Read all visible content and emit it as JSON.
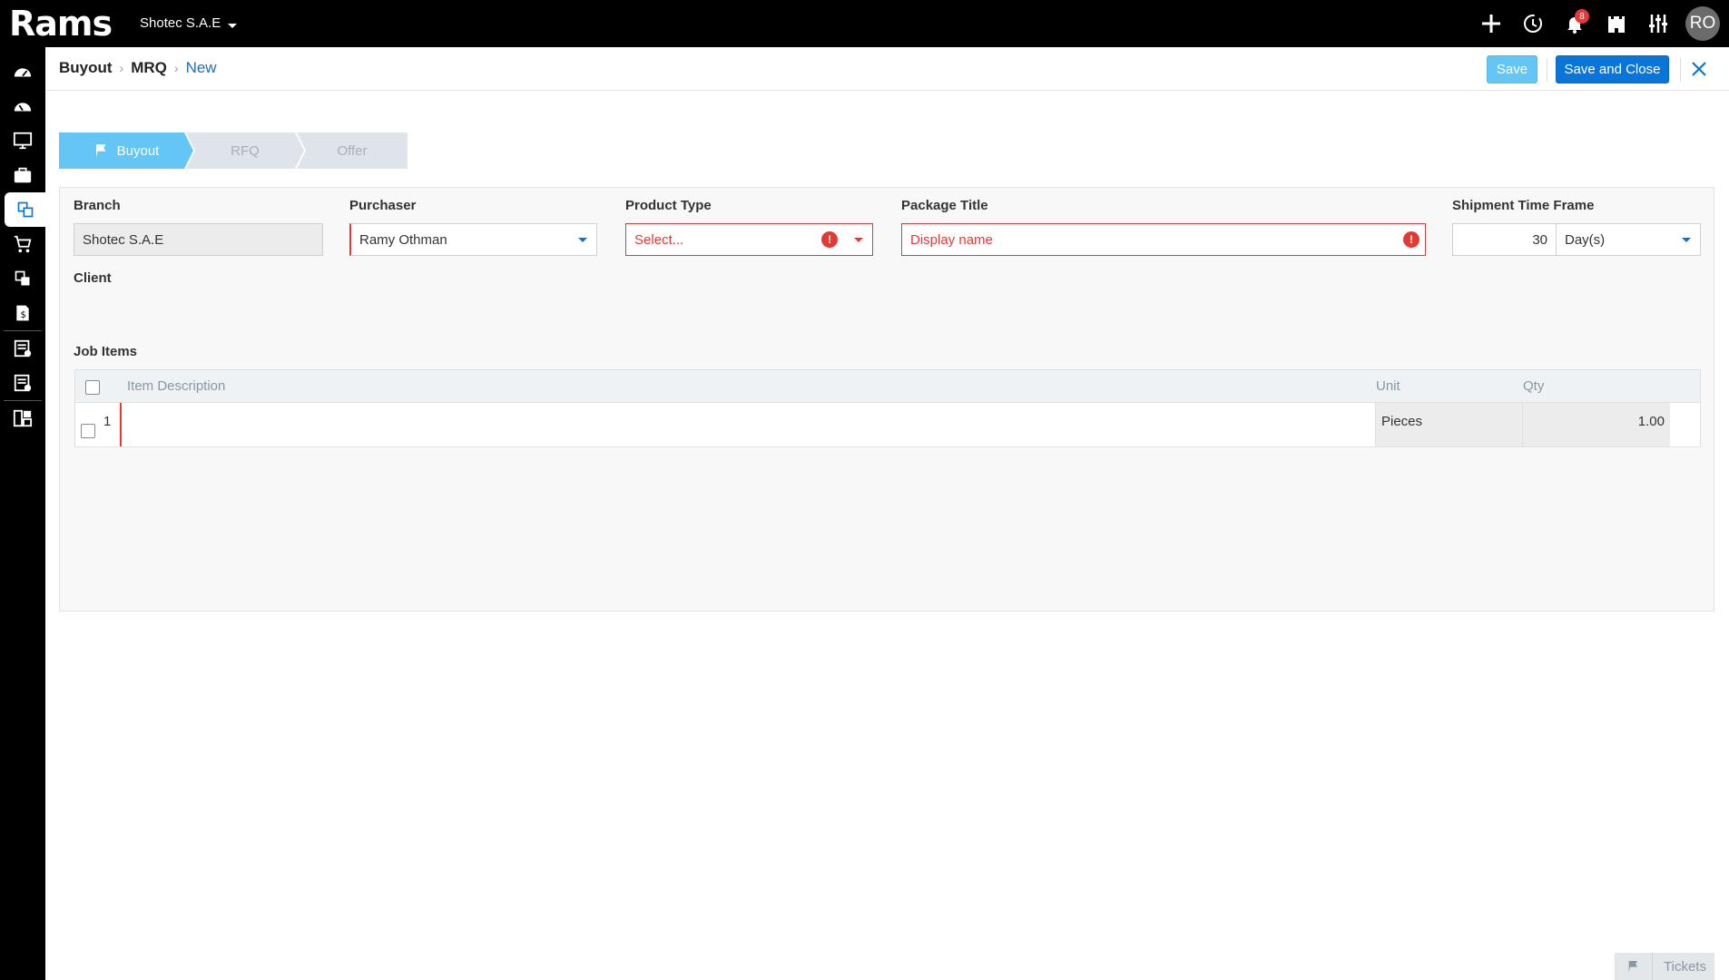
{
  "app": {
    "logo_text": "Rams",
    "company": "Shotec S.A.E",
    "notification_count": "8",
    "user_initials": "RO"
  },
  "topbar_icons": [
    "plus-icon",
    "history-icon",
    "bell-icon",
    "castle-icon",
    "sliders-icon"
  ],
  "sidebar": {
    "items": [
      "dashboard-icon",
      "speedometer-icon",
      "monitor-icon",
      "briefcase-icon",
      "buyout-icon",
      "cart-icon",
      "transfer-icon",
      "invoice-icon",
      "checklist-icon",
      "approval-icon",
      "report-icon"
    ],
    "active_index": 4
  },
  "breadcrumb": {
    "items": [
      "Buyout",
      "MRQ"
    ],
    "current": "New"
  },
  "actions": {
    "save_label": "Save",
    "save_close_label": "Save and Close"
  },
  "steps": [
    "Buyout",
    "RFQ",
    "Offer"
  ],
  "form": {
    "branch": {
      "label": "Branch",
      "value": "Shotec S.A.E"
    },
    "purchaser": {
      "label": "Purchaser",
      "value": "Ramy  Othman"
    },
    "product_type": {
      "label": "Product Type",
      "placeholder": "Select..."
    },
    "package_title": {
      "label": "Package Title",
      "placeholder": "Display name"
    },
    "shipment": {
      "label": "Shipment Time Frame",
      "value": "30",
      "unit": "Day(s)"
    },
    "client": {
      "label": "Client"
    },
    "job_items": {
      "label": "Job Items"
    }
  },
  "table": {
    "headers": {
      "description": "Item Description",
      "unit": "Unit",
      "qty": "Qty"
    },
    "rows": [
      {
        "index": "1",
        "description": "",
        "unit": "Pieces",
        "qty": "1.00"
      }
    ]
  },
  "footer": {
    "tickets_label": "Tickets"
  },
  "colors": {
    "accent_light": "#64c6f5",
    "accent": "#0a75d8",
    "error": "#e53935",
    "topbar": "#000000"
  }
}
